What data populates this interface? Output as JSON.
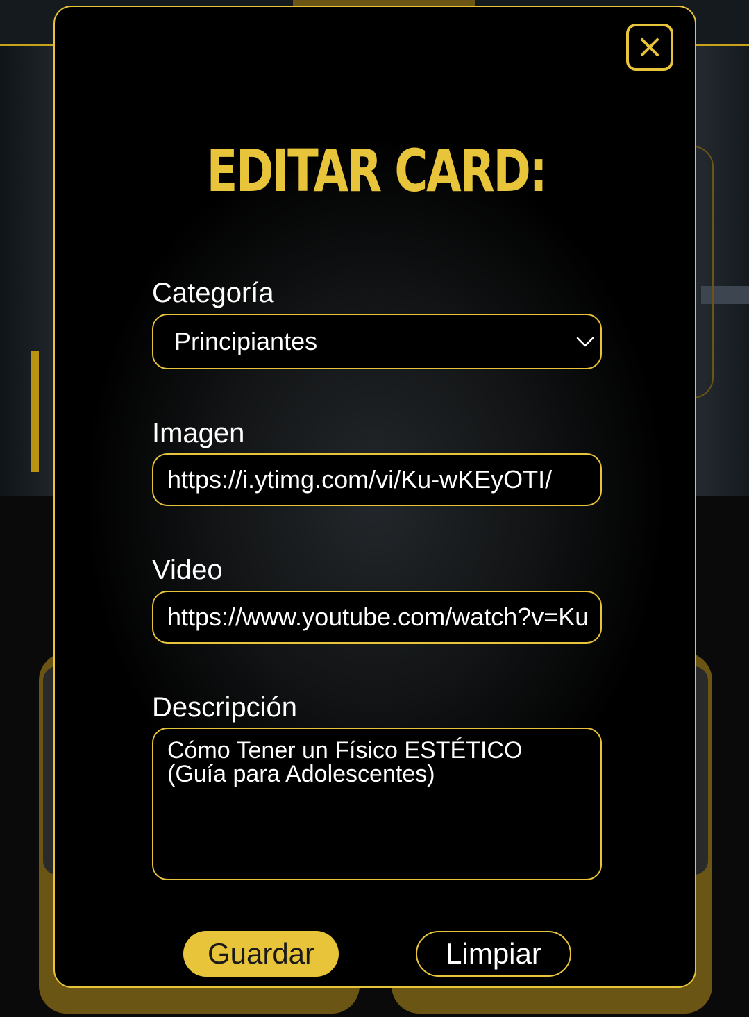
{
  "modal": {
    "title": "EDITAR CARD:",
    "close_icon": "close-icon"
  },
  "form": {
    "category": {
      "label": "Categoría",
      "selected": "Principiantes"
    },
    "image": {
      "label": "Imagen",
      "value": "https://i.ytimg.com/vi/Ku-wKEyOTI/"
    },
    "video": {
      "label": "Video",
      "value": "https://www.youtube.com/watch?v=Ku"
    },
    "description": {
      "label": "Descripción",
      "value": "Cómo Tener un Físico ESTÉTICO (Guía para Adolescentes)"
    }
  },
  "buttons": {
    "save": "Guardar",
    "clear": "Limpiar"
  },
  "colors": {
    "accent": "#e8c43a",
    "background": "#000000",
    "text": "#ffffff"
  }
}
